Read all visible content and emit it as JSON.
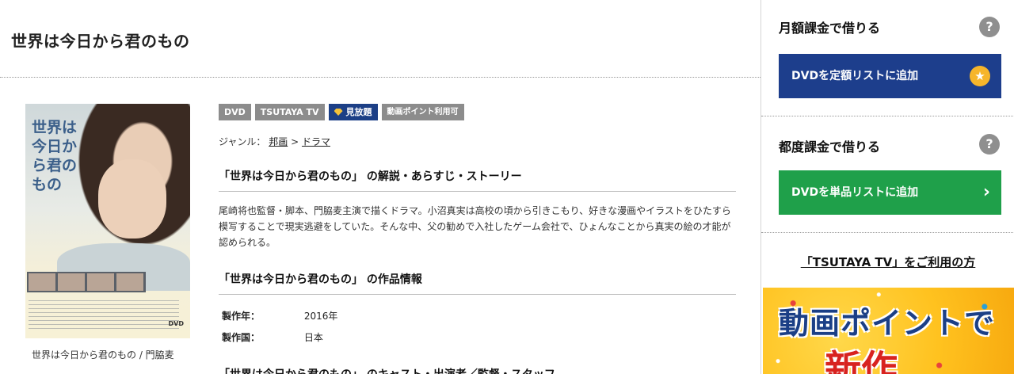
{
  "page": {
    "title": "世界は今日から君のもの"
  },
  "jacket": {
    "title_text": "世界は今日から君のもの",
    "caption": "世界は今日から君のもの / 門脇麦",
    "format_mark": "DVD"
  },
  "badges": [
    "DVD",
    "TSUTAYA TV",
    "見放題",
    "動画ポイント利用可"
  ],
  "genre": {
    "label": "ジャンル：",
    "items": [
      "邦画",
      "ドラマ"
    ],
    "separator": ">"
  },
  "sections": {
    "story_heading": "「世界は今日から君のもの」 の解説・あらすじ・ストーリー",
    "story_text": "尾崎将也監督・脚本、門脇麦主演で描くドラマ。小沼真実は高校の頃から引きこもり、好きな漫画やイラストをひたすら模写することで現実逃避をしていた。そんな中、父の勧めで入社したゲーム会社で、ひょんなことから真実の絵の才能が認められる。",
    "info_heading": "「世界は今日から君のもの」 の作品情報",
    "info": [
      {
        "key": "製作年：",
        "value": "2016年"
      },
      {
        "key": "製作国：",
        "value": "日本"
      }
    ],
    "cast_heading": "「世界は今日から君のもの」 のキャスト・出演者／監督・スタッフ"
  },
  "sidebar": {
    "monthly_heading": "月額課金で借りる",
    "monthly_button": "DVDを定額リストに追加",
    "per_heading": "都度課金で借りる",
    "per_button": "DVDを単品リストに追加",
    "help_glyph": "?",
    "tv_link": "「TSUTAYA TV」をご利用の方",
    "banner_line1": "動画ポイントで",
    "banner_line2": "新作"
  },
  "icons": {
    "star": "star-icon",
    "chevron": "chevron-right-icon",
    "help": "question-icon",
    "gem": "diamond-icon"
  },
  "colors": {
    "navy": "#1d3e8c",
    "green": "#1fa04a",
    "badge_gray": "#8c8c8c",
    "badge_blue": "#1c3f86",
    "star": "#f6b52b"
  }
}
